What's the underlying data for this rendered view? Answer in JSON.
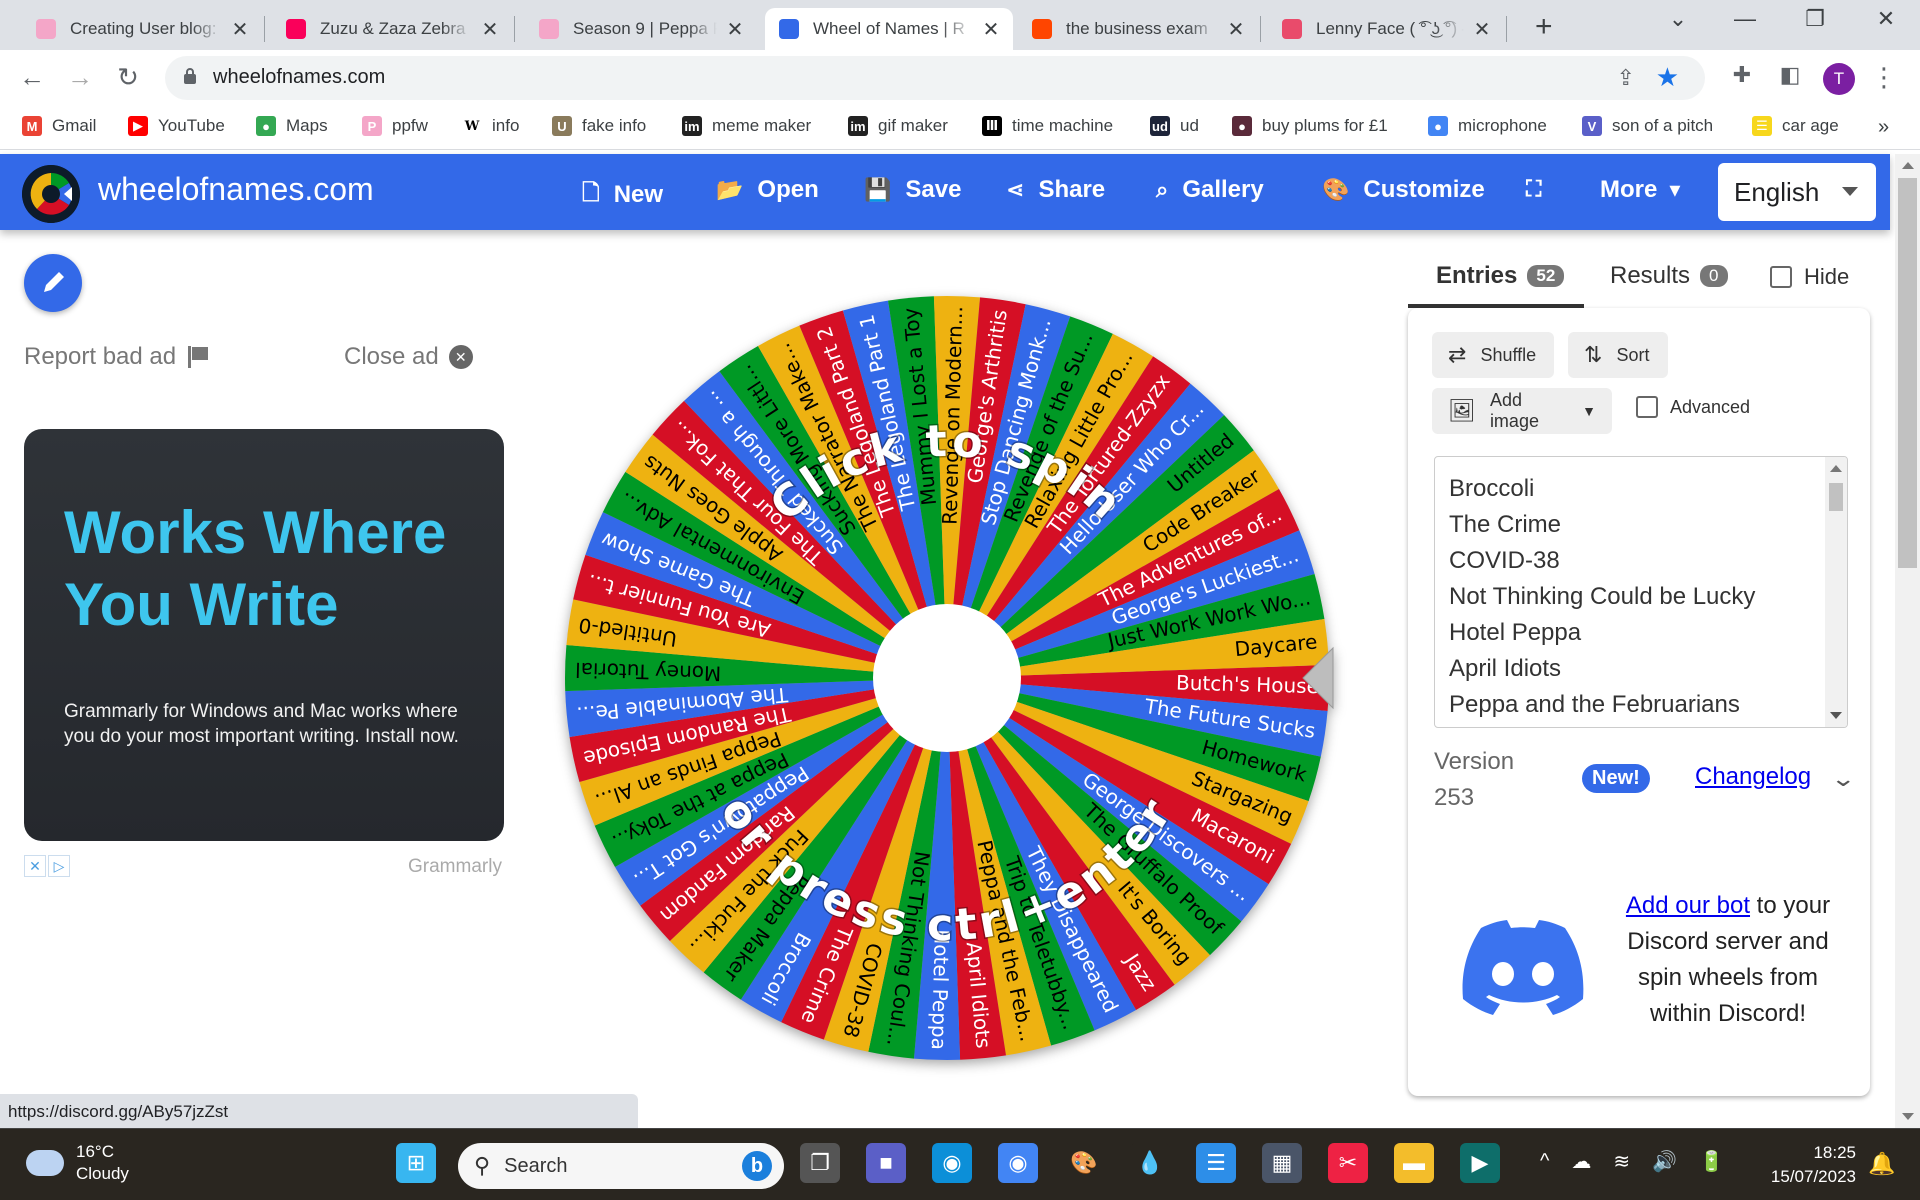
{
  "browser": {
    "tabs": [
      {
        "title": "Creating User blog:",
        "favicon": "peppa-pig-icon",
        "color": "#f4a6c8",
        "active": false
      },
      {
        "title": "Zuzu & Zaza Zebra",
        "favicon": "fandom-flame-icon",
        "color": "#fa005a",
        "active": false
      },
      {
        "title": "Season 9 | Peppa Pi",
        "favicon": "peppa-pig-icon",
        "color": "#f4a6c8",
        "active": false
      },
      {
        "title": "Wheel of Names | R",
        "favicon": "wheel-of-names-icon",
        "color": "#3369e8",
        "active": true
      },
      {
        "title": "the business exam",
        "favicon": "reddit-icon",
        "color": "#ff4500",
        "active": false
      },
      {
        "title": "Lenny Face ( ͡° ͜ʖ ͡°) –",
        "favicon": "lenny-face-icon",
        "color": "#e94b6b",
        "active": false
      }
    ],
    "new_tab_label": "+",
    "address": "wheelofnames.com",
    "avatar_letter": "T",
    "bookmarks": [
      {
        "label": "Gmail",
        "icon": "gmail-icon",
        "glyph": "M",
        "color": "#ea4335"
      },
      {
        "label": "YouTube",
        "icon": "youtube-icon",
        "glyph": "▶",
        "color": "#ff0000"
      },
      {
        "label": "Maps",
        "icon": "maps-pin-icon",
        "glyph": "●",
        "color": "#34a853"
      },
      {
        "label": "ppfw",
        "icon": "peppa-pig-icon",
        "glyph": "P",
        "color": "#f4a6c8"
      },
      {
        "label": "info",
        "icon": "wikipedia-icon",
        "glyph": "W",
        "color": "#ffffff"
      },
      {
        "label": "fake info",
        "icon": "uncyclopedia-icon",
        "glyph": "U",
        "color": "#8a7b5c"
      },
      {
        "label": "meme maker",
        "icon": "imgflip-icon",
        "glyph": "im",
        "color": "#222222"
      },
      {
        "label": "gif maker",
        "icon": "imgflip-icon",
        "glyph": "im",
        "color": "#222222"
      },
      {
        "label": "time machine",
        "icon": "archive-icon",
        "glyph": "Ⅲ",
        "color": "#000000"
      },
      {
        "label": "ud",
        "icon": "urban-dictionary-icon",
        "glyph": "ud",
        "color": "#1d2439"
      },
      {
        "label": "buy plums for £1",
        "icon": "plum-icon",
        "glyph": "●",
        "color": "#5a2a3a"
      },
      {
        "label": "microphone",
        "icon": "google-assistant-icon",
        "glyph": "●",
        "color": "#4285f4"
      },
      {
        "label": "son of a pitch",
        "icon": "vocaroo-icon",
        "glyph": "V",
        "color": "#5a5fc8"
      },
      {
        "label": "car age",
        "icon": "car-age-icon",
        "glyph": "☰",
        "color": "#f7d71c"
      }
    ],
    "bookmarks_overflow": "»",
    "status_url": "https://discord.gg/ABy57jzZst"
  },
  "site": {
    "brand": "wheelofnames.com",
    "nav": [
      {
        "label": "New",
        "icon": "file-icon",
        "glyph": "🗋"
      },
      {
        "label": "Open",
        "icon": "folder-open-icon",
        "glyph": "📂"
      },
      {
        "label": "Save",
        "icon": "floppy-disk-icon",
        "glyph": "💾"
      },
      {
        "label": "Share",
        "icon": "share-icon",
        "glyph": "⋖"
      },
      {
        "label": "Gallery",
        "icon": "search-icon",
        "glyph": "⌕"
      },
      {
        "label": "Customize",
        "icon": "palette-icon",
        "glyph": "🎨"
      },
      {
        "label": "",
        "icon": "fullscreen-icon",
        "glyph": "⛶"
      },
      {
        "label": "More",
        "icon": "caret-down-icon",
        "glyph": "▾"
      }
    ],
    "language": "English"
  },
  "ad": {
    "report_label": "Report bad ad",
    "close_label": "Close ad",
    "headline_line1": "Works Where",
    "headline_line2": "You Write",
    "body": "Grammarly for Windows and Mac works where you do your most important writing. Install now.",
    "sponsor": "Grammarly"
  },
  "wheel": {
    "center_text_top": "Click to spin",
    "center_text_bottom": "or press ctrl+enter",
    "colors": [
      "#d50f25",
      "#3369e8",
      "#009925",
      "#eeb211"
    ],
    "label_colors": [
      "#ffffff",
      "#ffffff",
      "#000000",
      "#000000"
    ],
    "segments": [
      "Butch's House",
      "The Future Sucks",
      "Homework",
      "Stargazing",
      "Macaroni",
      "George Discovers ...",
      "The Gruffalo Proof",
      "It's Boring",
      "Jazz",
      "They Disappeared",
      "Trip to Teletubby...",
      "Peppa and the Feb...",
      "April Idiots",
      "Hotel Peppa",
      "Not Thinking Coul...",
      "COVID-38",
      "The Crime",
      "Broccoli",
      "Peppa Maker",
      "Fuck the Fucki...",
      "Random Fandom",
      "Peppatown's Got T...",
      "Peppa at the Toky...",
      "Peppa Finds an Al...",
      "The Random Episode",
      "The Abominable Pe...",
      "Money Tutorial",
      "Untitled-0",
      "Are You Funnier t...",
      "The Game Show",
      "Environmental Adv...",
      "Apple Goes Nuts",
      "The Four That Fok...",
      "Sucked Through a ...",
      "Sucking More Littl...",
      "The Narrator Make...",
      "The Legoland Part 2",
      "The Legoland Part 1",
      "Mummy I Lost a Toy",
      "Revenge on Modern...",
      "George's Arthritis",
      "Stop Dancing Monk...",
      "Revenge of the Su...",
      "Relaxing Little Pro...",
      "The Tortured-Zzyzx",
      "Hello User Who Cr...",
      "Untitled",
      "Code Breaker",
      "The Adventures of...",
      "George's Luckiest...",
      "Just Work Work Wo...",
      "Daycare"
    ],
    "selected": "Butch's House"
  },
  "panel": {
    "tabs": [
      {
        "label": "Entries",
        "count": "52",
        "active": true
      },
      {
        "label": "Results",
        "count": "0",
        "active": false
      }
    ],
    "hide_label": "Hide",
    "shuffle_label": "Shuffle",
    "sort_label": "Sort",
    "add_image_label": "Add image",
    "advanced_label": "Advanced",
    "entries_visible": [
      "Broccoli",
      "The Crime",
      "COVID-38",
      "Not Thinking Could be Lucky",
      "Hotel Peppa",
      "April Idiots",
      "Peppa and the Februarians"
    ],
    "version_label": "Version",
    "version_number": "253",
    "new_badge": "New!",
    "changelog_label": "Changelog",
    "discord_link": "Add our bot",
    "discord_text": " to your Discord server and spin wheels from within Discord!"
  },
  "taskbar": {
    "weather_temp": "16°C",
    "weather_desc": "Cloudy",
    "search_placeholder": "Search",
    "apps": [
      {
        "name": "start-icon",
        "glyph": "⊞",
        "color": "#38b6f0"
      },
      {
        "name": "task-view-icon",
        "glyph": "❐",
        "color": "#555"
      },
      {
        "name": "teams-chat-icon",
        "glyph": "■",
        "color": "#5b5fc7"
      },
      {
        "name": "edge-icon",
        "glyph": "◉",
        "color": "#0c8fd8"
      },
      {
        "name": "chrome-icon",
        "glyph": "◉",
        "color": "#4285f4"
      },
      {
        "name": "paint-icon",
        "glyph": "🎨",
        "color": "#2a2620"
      },
      {
        "name": "paint3d-icon",
        "glyph": "💧",
        "color": "#2a2620"
      },
      {
        "name": "notepad-icon",
        "glyph": "☰",
        "color": "#2d8ee8"
      },
      {
        "name": "calculator-icon",
        "glyph": "▦",
        "color": "#4a5568"
      },
      {
        "name": "snipping-tool-icon",
        "glyph": "✂",
        "color": "#e24"
      },
      {
        "name": "file-explorer-icon",
        "glyph": "▬",
        "color": "#f3bd2b"
      },
      {
        "name": "video-editor-icon",
        "glyph": "▶",
        "color": "#0e6e6a"
      }
    ],
    "tray": [
      "^",
      "☁",
      "≋",
      "🔊",
      "🔋"
    ],
    "time": "18:25",
    "date": "15/07/2023"
  }
}
